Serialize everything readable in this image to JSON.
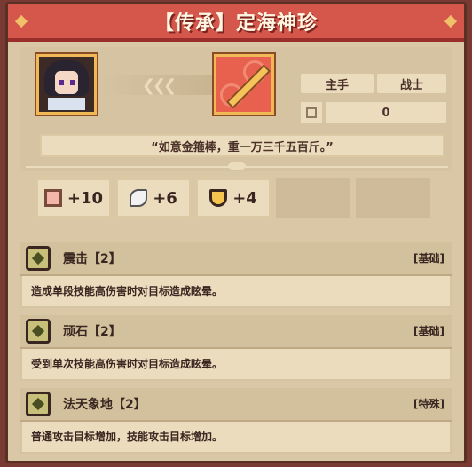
{
  "title": "【传承】定海神珍",
  "item": {
    "slot": "主手",
    "class": "战士",
    "count": "0",
    "quote": "“如意金箍棒，重一万三千五百斤。”",
    "arrows": "❮❮❮"
  },
  "stats": [
    {
      "icon": "power-icon",
      "value": "+10"
    },
    {
      "icon": "feather-icon",
      "value": "+6"
    },
    {
      "icon": "shield-icon",
      "value": "+4"
    }
  ],
  "skills": [
    {
      "icon": "skill-icon",
      "name": "震击【2】",
      "type": "[基础]",
      "desc": "造成单段技能高伤害时对目标造成眩晕。"
    },
    {
      "icon": "skill-icon",
      "name": "顽石【2】",
      "type": "[基础]",
      "desc": "受到单次技能高伤害时对目标造成眩晕。"
    },
    {
      "icon": "skill-icon",
      "name": "法天象地【2】",
      "type": "[特殊]",
      "desc": "普通攻击目标增加，技能攻击目标增加。"
    }
  ]
}
